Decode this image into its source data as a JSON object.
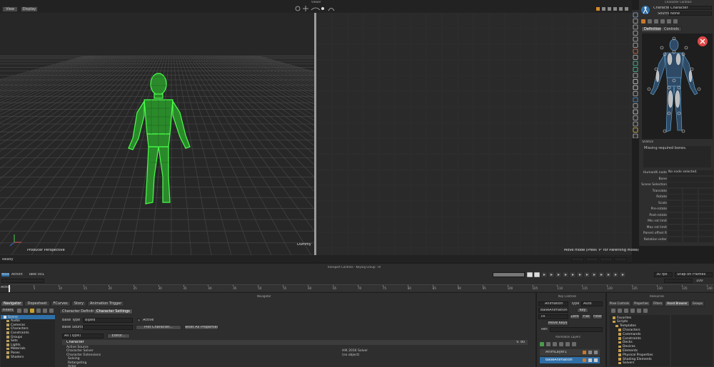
{
  "viewer": {
    "title": "Viewer",
    "view_btn": "View",
    "display_btn": "Display",
    "camera_label": "Producer Perspective",
    "character_label": "Dummy",
    "move_mode_hint": "Move mode (Press 'P' for Parenting mode)",
    "status": "Ready"
  },
  "character_controls": {
    "title": "Character Controls",
    "character_label": "Character",
    "character_value": "Character",
    "source_label": "Source",
    "source_value": "None",
    "tabs": [
      "Definition",
      "Controls"
    ],
    "status_label": "Status",
    "status_message": "Missing required bones.",
    "props": [
      {
        "label": "HumanIK node",
        "value": "No node selected."
      },
      {
        "label": "Bone",
        "value": ""
      },
      {
        "label": "Scene Selection",
        "value": ""
      },
      {
        "label": "Translate",
        "value": ""
      },
      {
        "label": "Rotate",
        "value": ""
      },
      {
        "label": "Scale",
        "value": ""
      },
      {
        "label": "Pre-rotate",
        "value": ""
      },
      {
        "label": "Post-rotate",
        "value": ""
      },
      {
        "label": "Min rot limit",
        "value": ""
      },
      {
        "label": "Max rot limit",
        "value": ""
      },
      {
        "label": "Parent offset R",
        "value": ""
      },
      {
        "label": "Rotation order",
        "value": ""
      }
    ]
  },
  "transport": {
    "title": "Transport Controls  -  Keying Group: TR",
    "move_btn": "Move",
    "action_label": "Action",
    "take_label": "Take 001",
    "fps_value": "30 fps",
    "snap_value": "Snap on Frames",
    "timeline_label": "Action",
    "end_frame": "100",
    "ticks": [
      "0",
      "5",
      "10",
      "15",
      "20",
      "25",
      "30",
      "35",
      "40",
      "45",
      "50",
      "55",
      "60",
      "65",
      "70",
      "75",
      "80",
      "85",
      "90",
      "95",
      "100",
      "105",
      "110",
      "115",
      "120",
      "125",
      "130",
      "135",
      "140"
    ]
  },
  "navigator": {
    "title": "Navigator",
    "tabs": [
      "Navigator",
      "Dopesheet",
      "FCurves",
      "Story",
      "Animation Trigger"
    ],
    "filters_label": "Filters",
    "tree": [
      "Scene",
      "Audio",
      "Cameras",
      "Characters",
      "Constraints",
      "Groups",
      "Sets",
      "Lights",
      "Materials",
      "Poses",
      "Shaders"
    ],
    "sub_tabs": [
      "Character Definition",
      "Character Settings"
    ],
    "base_type_label": "Base Type",
    "base_type_value": "Biped",
    "active_label": "Active",
    "base_source_label": "Base Source",
    "plot_character_btn": "Plot Character...",
    "reset_props_btn": "Reset All Properties",
    "filter_value": "All (Type)",
    "editor_btn": "Editor...",
    "group_header": "Character",
    "group_version": "V. 80",
    "rows": [
      {
        "label": "Active Source",
        "value": ""
      },
      {
        "label": "Character Solver",
        "value": "HIK 2016 Solver"
      },
      {
        "label": "Character Extensions",
        "value": "(no object)"
      },
      {
        "label": "Solving",
        "value": ""
      },
      {
        "label": "Retargeting",
        "value": ""
      },
      {
        "label": "Actor",
        "value": ""
      }
    ]
  },
  "key_controls": {
    "title": "Key Controls",
    "mode_value": "Animation",
    "type_label": "Type",
    "type_value": "Auto",
    "layer_value": "BaseAnimation",
    "key_btn": "Key",
    "keying_value": "TR",
    "zero_btn": "Zero",
    "flat_btn": "Flat",
    "filter_btn": "Filter",
    "move_keys_btn": "Move Keys",
    "ref_label": "Ref:",
    "layers_title": "Animation Layers",
    "layers": [
      "AnimLayer1",
      "BaseAnimation"
    ]
  },
  "resources": {
    "title": "Resources",
    "tabs": [
      "Pose Controls",
      "Properties",
      "Filters",
      "Asset Browser",
      "Groups"
    ],
    "tree": [
      "Favorites",
      "Scripts",
      "Templates",
      "Characters",
      "Commands",
      "Constraints",
      "Decks",
      "Devices",
      "Elements",
      "Physical Properties",
      "Shading Elements",
      "Solvers"
    ]
  },
  "colors": {
    "bg": "#2b2b2b",
    "panel": "#2e2e2e",
    "header": "#3a3a3a",
    "accent_blue": "#2f6fa8",
    "wire_green": "#3cff3c",
    "close_red": "#e04848"
  }
}
